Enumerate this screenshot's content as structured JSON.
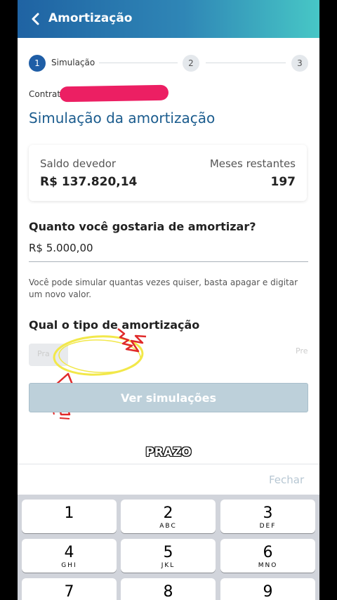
{
  "header": {
    "title": "Amortização",
    "back_icon": "chevron-left-icon"
  },
  "stepper": {
    "steps": [
      {
        "number": "1",
        "label": "Simulação"
      },
      {
        "number": "2",
        "label": ""
      },
      {
        "number": "3",
        "label": ""
      }
    ]
  },
  "contract_label": "Contrato",
  "page_title": "Simulação da amortização",
  "summary": {
    "balance_label": "Saldo devedor",
    "balance_value": "R$ 137.820,14",
    "months_label": "Meses restantes",
    "months_value": "197"
  },
  "amount": {
    "question": "Quanto você gostaria de amortizar?",
    "value": "R$ 5.000,00"
  },
  "helper_text": "Você pode simular quantas vezes quiser, basta apagar e digitar um novo valor.",
  "type_section": {
    "question": "Qual o tipo de amortização",
    "option_left": "Pra",
    "option_right": "Pre"
  },
  "cta_label": "Ver simulações",
  "caption": "PRAZO",
  "close_label": "Fechar",
  "keypad": [
    {
      "num": "1",
      "letters": ""
    },
    {
      "num": "2",
      "letters": "ABC"
    },
    {
      "num": "3",
      "letters": "DEF"
    },
    {
      "num": "4",
      "letters": "GHI"
    },
    {
      "num": "5",
      "letters": "JKL"
    },
    {
      "num": "6",
      "letters": "MNO"
    },
    {
      "num": "7",
      "letters": ""
    },
    {
      "num": "8",
      "letters": ""
    },
    {
      "num": "9",
      "letters": ""
    }
  ],
  "colors": {
    "brand": "#1f5ea6",
    "title_blue": "#1b5c8e",
    "redaction": "#ec1f63",
    "annotation_yellow": "#f2e84a",
    "annotation_red": "#e02a2a"
  }
}
